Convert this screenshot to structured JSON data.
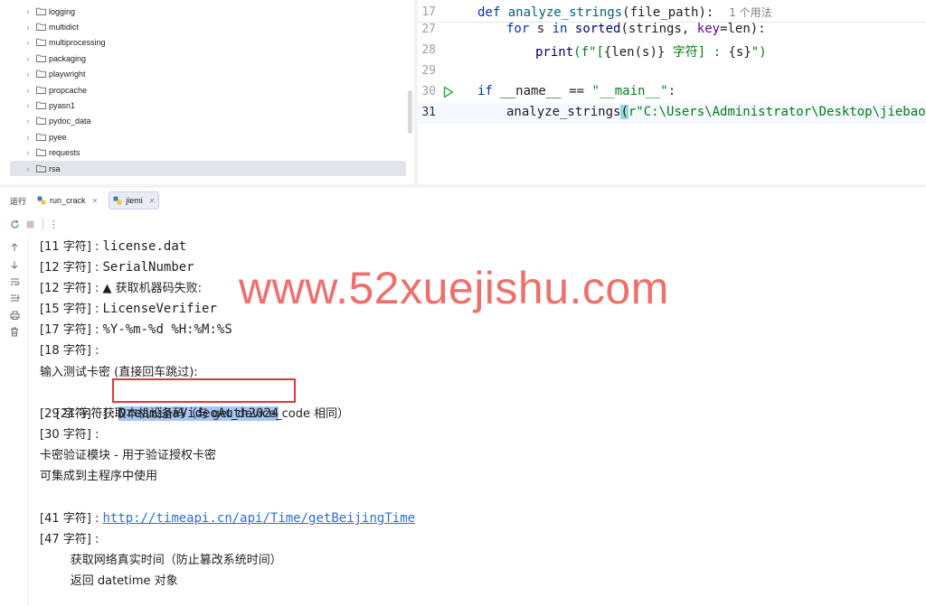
{
  "project_tree": {
    "items": [
      {
        "label": "logging",
        "selected": false
      },
      {
        "label": "multidict",
        "selected": false
      },
      {
        "label": "multiprocessing",
        "selected": false
      },
      {
        "label": "packaging",
        "selected": false
      },
      {
        "label": "playwright",
        "selected": false
      },
      {
        "label": "propcache",
        "selected": false
      },
      {
        "label": "pyasn1",
        "selected": false
      },
      {
        "label": "pydoc_data",
        "selected": false
      },
      {
        "label": "pyee",
        "selected": false
      },
      {
        "label": "requests",
        "selected": false
      },
      {
        "label": "rsa",
        "selected": true
      }
    ]
  },
  "editor": {
    "lines": [
      {
        "num": "17"
      },
      {
        "num": "27"
      },
      {
        "num": "28"
      },
      {
        "num": "29"
      },
      {
        "num": "30"
      },
      {
        "num": "31"
      }
    ],
    "line17": {
      "kw": "def",
      "fn": "analyze_strings",
      "rest": "(file_path):",
      "hint": "1 个用法"
    },
    "line27": {
      "kw1": "for",
      "mid1": " s ",
      "kw2": "in",
      "bi": "sorted",
      "rest1": "(strings, ",
      "kwarg": "key",
      "rest2": "=len):"
    },
    "line28": {
      "bi": "print",
      "p1": "(f\"[",
      "p2": "{len(s)}",
      "p3": " 字符] : ",
      "p4": "{s}",
      "p5": "\")"
    },
    "line30": {
      "kw": "if",
      "rest1": " __name__ == ",
      "str": "\"__main__\"",
      "rest2": ":"
    },
    "line31": {
      "fn": "analyze_strings",
      "brace": "(",
      "str": "r\"C:\\Users\\Administrator\\Desktop\\jiebao\\PY"
    }
  },
  "run_panel": {
    "title": "运行",
    "tabs": [
      {
        "label": "run_crack",
        "active": false
      },
      {
        "label": "jiemi",
        "active": true
      }
    ]
  },
  "console": {
    "lines": [
      {
        "prefix": "[11 字符] : ",
        "value": "license.dat"
      },
      {
        "prefix": "[12 字符] : ",
        "value": "SerialNumber"
      },
      {
        "prefix": "[12 字符] : ",
        "value": "▲ 获取机器码失败:"
      },
      {
        "prefix": "[15 字符] : ",
        "value": "LicenseVerifier"
      },
      {
        "prefix": "[17 字符] : ",
        "value": "%Y-%m-%d %H:%M:%S"
      },
      {
        "prefix": "[18 字符] : ",
        "value": ""
      },
      {
        "prefix": "",
        "value": "输入测试卡密 (直接回车跳过):"
      },
      {
        "prefix": "[21 字符] : ",
        "value": "DreaminaVideoAuth2024"
      },
      {
        "prefix": "[29 字符] : ",
        "value": "获取本机设备码（与 get_device_code 相同）"
      },
      {
        "prefix": "[30 字符] : ",
        "value": ""
      },
      {
        "prefix": "",
        "value": "卡密验证模块 - 用于验证授权卡密"
      },
      {
        "prefix": "",
        "value": "可集成到主程序中使用"
      },
      {
        "prefix": "",
        "value": ""
      },
      {
        "prefix": "[41 字符] : ",
        "value": "http://timeapi.cn/api/Time/getBeijingTime"
      },
      {
        "prefix": "[47 字符] : ",
        "value": ""
      },
      {
        "prefix": "    ",
        "value": "获取网络真实时间（防止篡改系统时间）"
      },
      {
        "prefix": "    ",
        "value": "返回 datetime 对象"
      }
    ]
  },
  "watermark": "www.52xuejishu.com",
  "colors": {
    "selection": "#a6c6f5",
    "highlight_box": "#e0383a",
    "link": "#2a6fdb",
    "watermark": "#ef6f6c"
  }
}
